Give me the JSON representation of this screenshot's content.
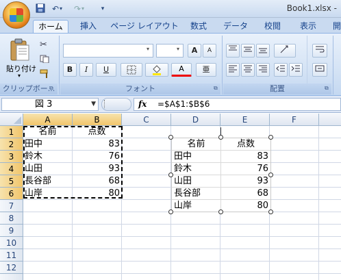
{
  "window": {
    "doc_title": "Book1.xlsx -"
  },
  "qat": {
    "save_icon": "save-icon",
    "undo_icon": "undo-icon",
    "redo_icon": "redo-icon",
    "customize_icon": "qat-customize-icon"
  },
  "tabs": [
    "ホーム",
    "挿入",
    "ページ レイアウト",
    "数式",
    "データ",
    "校閲",
    "表示",
    "開"
  ],
  "ribbon": {
    "clipboard": {
      "paste_label": "貼り付け",
      "group_label": "クリップボー..."
    },
    "font": {
      "group_label": "フォント",
      "bold": "B",
      "italic": "I",
      "underline": "U",
      "grow": "A",
      "shrink": "A",
      "font_color": "A",
      "phonetic": "亜"
    },
    "alignment": {
      "group_label": "配置"
    }
  },
  "formula_bar": {
    "name_box": "図 3",
    "fx": "fx",
    "formula": "=$A$1:$B$6"
  },
  "sheet": {
    "columns": [
      "A",
      "B",
      "C",
      "D",
      "E",
      "F"
    ],
    "rows": [
      "1",
      "2",
      "3",
      "4",
      "5",
      "6",
      "7",
      "8",
      "9",
      "10",
      "11",
      "12"
    ],
    "cells": [
      [
        "名前",
        "点数"
      ],
      [
        "田中",
        "83"
      ],
      [
        "鈴木",
        "76"
      ],
      [
        "山田",
        "93"
      ],
      [
        "長谷部",
        "68"
      ],
      [
        "山岸",
        "80"
      ]
    ]
  },
  "picture": {
    "rows": [
      [
        "名前",
        "点数"
      ],
      [
        "田中",
        "83"
      ],
      [
        "鈴木",
        "76"
      ],
      [
        "山田",
        "93"
      ],
      [
        "長谷部",
        "68"
      ],
      [
        "山岸",
        "80"
      ]
    ]
  }
}
